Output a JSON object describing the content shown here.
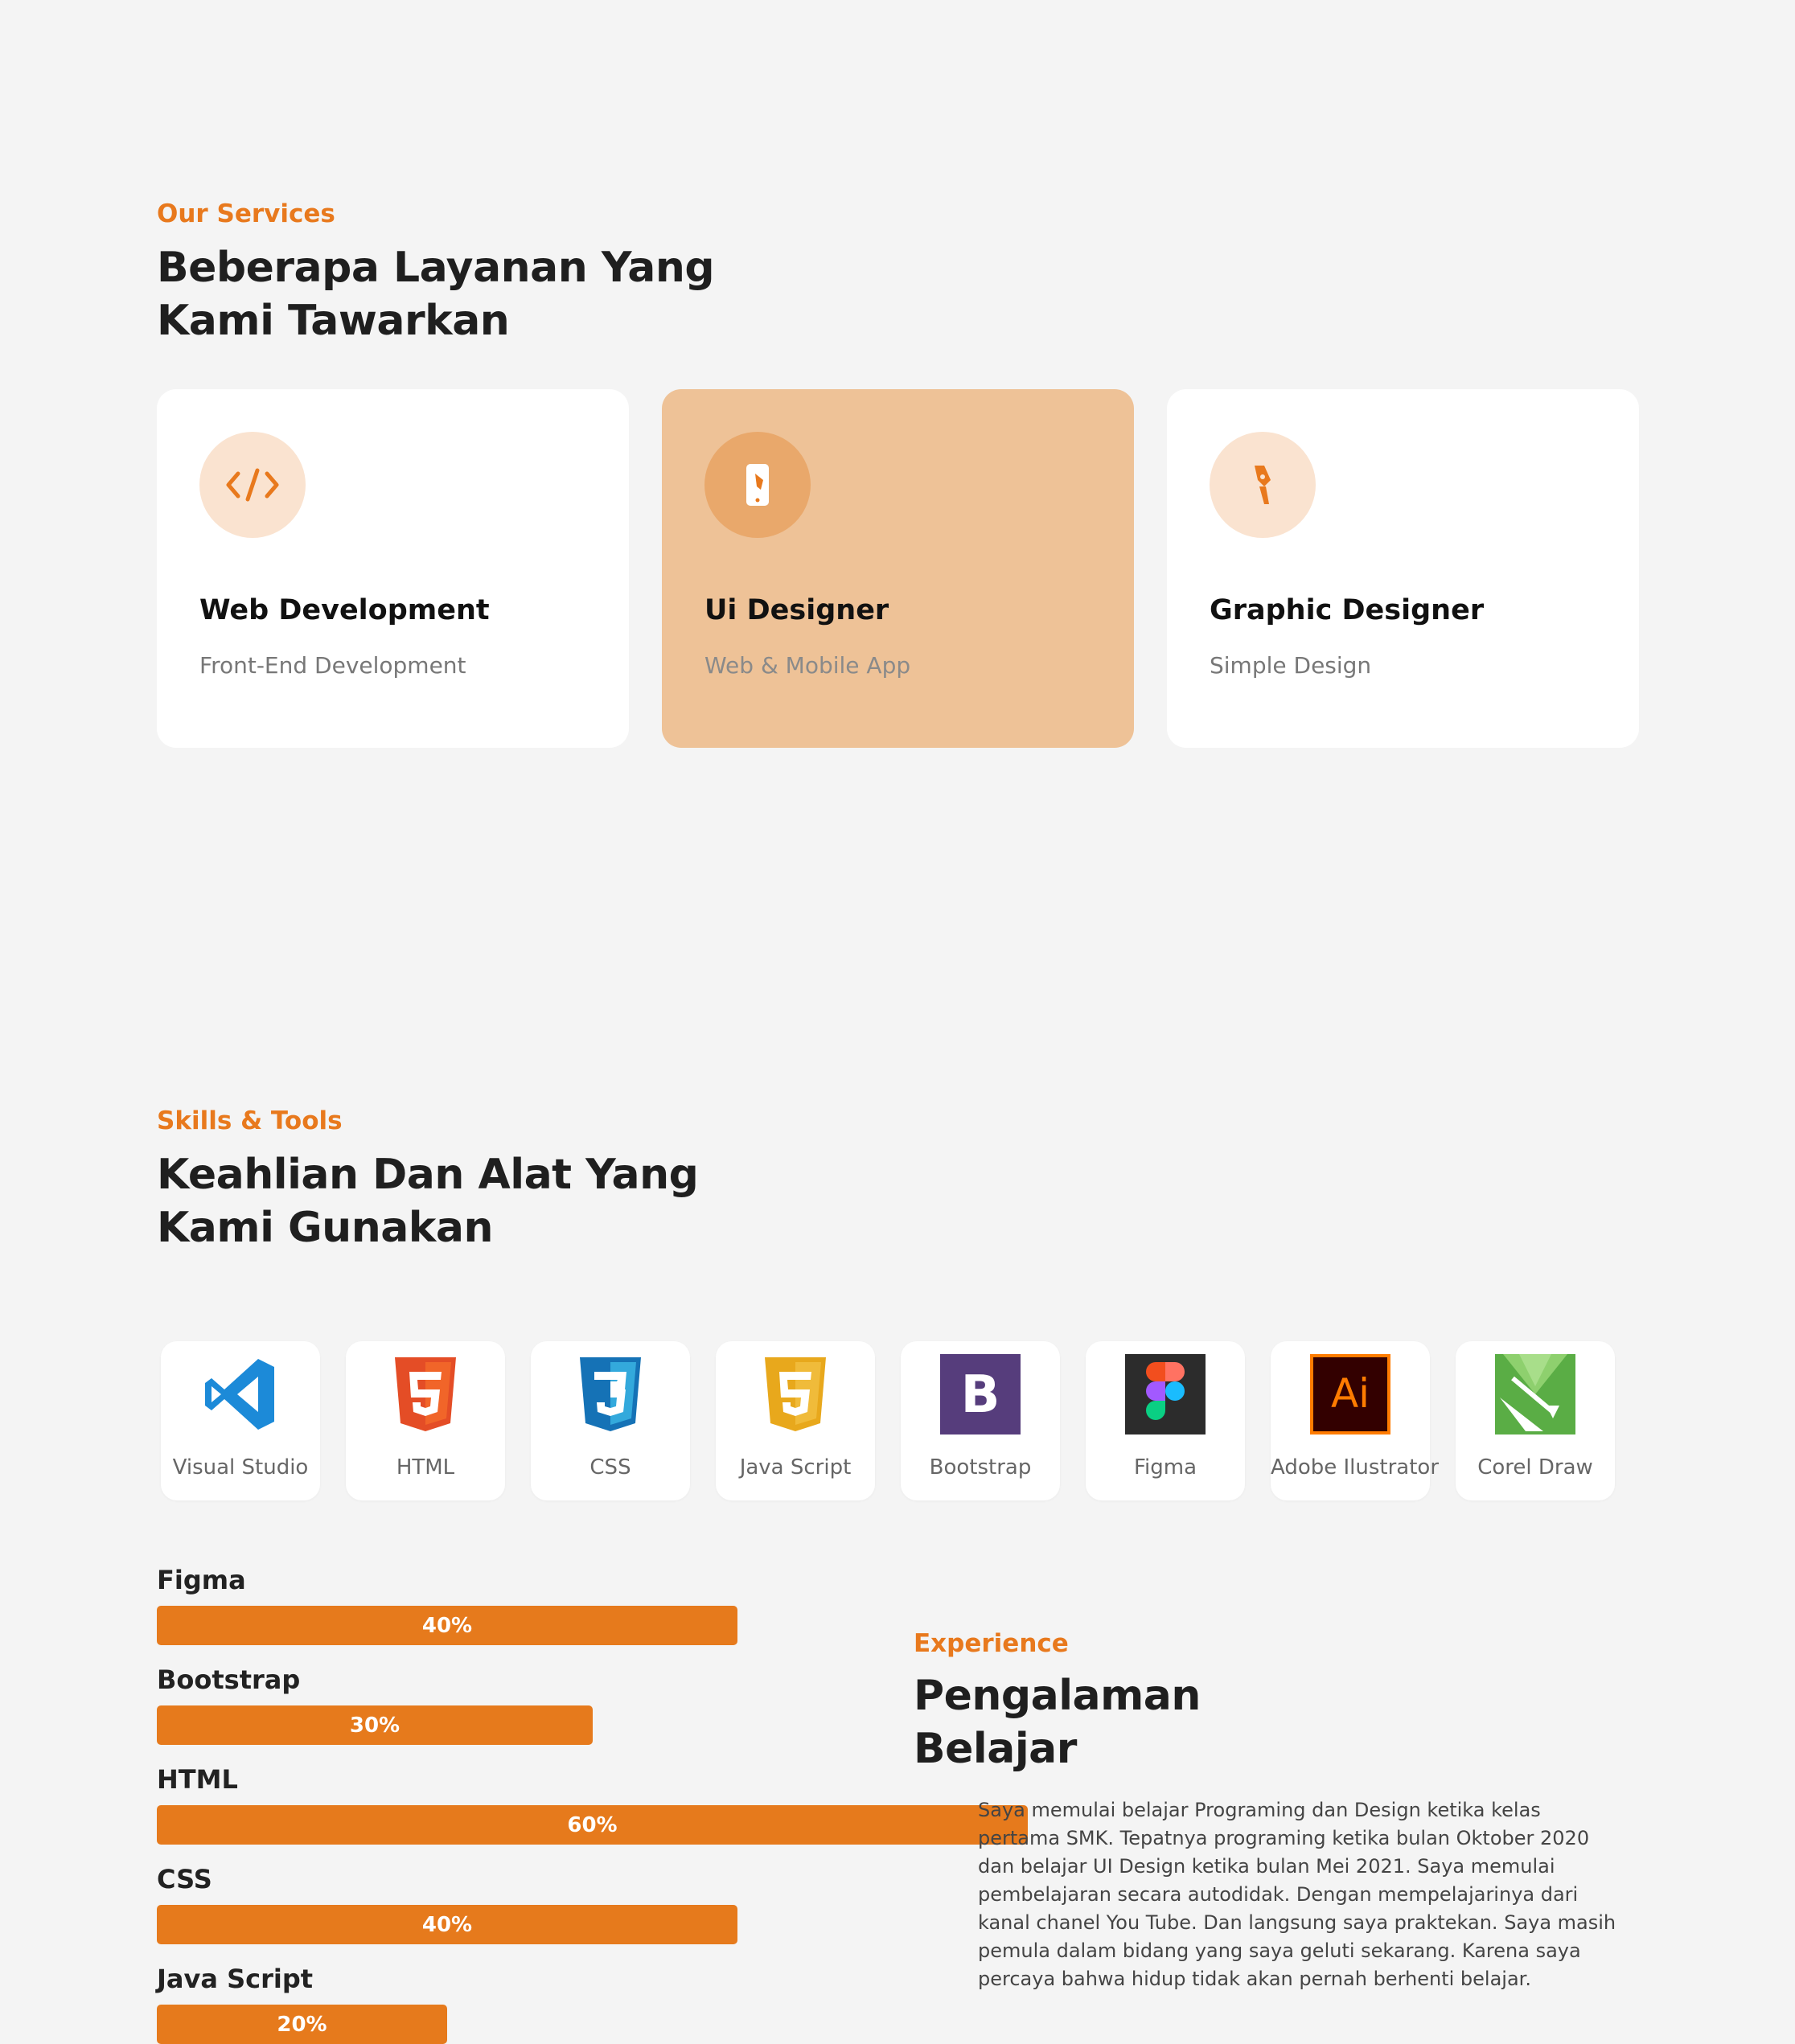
{
  "services": {
    "eyebrow": "Our Services",
    "heading": "Beberapa Layanan Yang Kami Tawarkan",
    "cards": [
      {
        "title": "Web Development",
        "subtitle": "Front-End Development",
        "icon": "code-icon"
      },
      {
        "title": "Ui Designer",
        "subtitle": "Web & Mobile App",
        "icon": "mobile-design-icon"
      },
      {
        "title": "Graphic Designer",
        "subtitle": "Simple Design",
        "icon": "pen-tool-icon"
      }
    ]
  },
  "skills": {
    "eyebrow": "Skills & Tools",
    "heading": "Keahlian Dan Alat Yang Kami Gunakan",
    "tools": [
      {
        "label": "Visual Studio",
        "icon": "vscode-icon"
      },
      {
        "label": "HTML",
        "icon": "html5-icon"
      },
      {
        "label": "CSS",
        "icon": "css3-icon"
      },
      {
        "label": "Java Script",
        "icon": "javascript-icon"
      },
      {
        "label": "Bootstrap",
        "icon": "bootstrap-icon"
      },
      {
        "label": "Figma",
        "icon": "figma-icon"
      },
      {
        "label": "Adobe Ilustrator",
        "icon": "illustrator-icon"
      },
      {
        "label": "Corel Draw",
        "icon": "coreldraw-icon"
      }
    ],
    "progress": [
      {
        "name": "Figma",
        "percent": 40,
        "text": "40%"
      },
      {
        "name": "Bootstrap",
        "percent": 30,
        "text": "30%"
      },
      {
        "name": "HTML",
        "percent": 60,
        "text": "60%"
      },
      {
        "name": "CSS",
        "percent": 40,
        "text": "40%"
      },
      {
        "name": "Java Script",
        "percent": 20,
        "text": "20%"
      }
    ]
  },
  "experience": {
    "eyebrow": "Experience",
    "heading": "Pengalaman Belajar",
    "text": "Saya memulai belajar Programing dan Design ketika kelas pertama SMK. Tepatnya programing ketika bulan Oktober 2020 dan belajar UI Design ketika bulan Mei 2021. Saya memulai pembelajaran secara autodidak. Dengan mempelajarinya dari kanal chanel You Tube. Dan langsung saya praktekan. Saya masih pemula dalam bidang yang saya geluti sekarang. Karena saya percaya bahwa hidup tidak akan pernah berhenti belajar."
  },
  "colors": {
    "accent": "#e67a1c",
    "active_card": "#eec297",
    "icon_circle": "#fae3d0",
    "background": "#f4f4f4"
  }
}
